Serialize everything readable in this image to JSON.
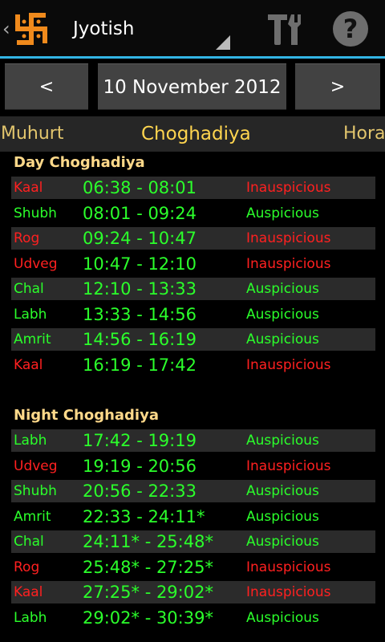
{
  "app": {
    "title": "Jyotish",
    "back_icon": "chevron-left-icon",
    "logo_icon": "swastika-logo-icon",
    "settings_icon": "tools-icon",
    "help_icon": "help-icon",
    "help_glyph": "?",
    "accent_color": "#33b5e5"
  },
  "date_nav": {
    "prev_label": "<",
    "date": "10 November 2012",
    "next_label": ">"
  },
  "tabs": {
    "left": "Muhurt",
    "active": "Choghadiya",
    "right": "Hora"
  },
  "day": {
    "title": "Day Choghadiya",
    "rows": [
      {
        "name": "Kaal",
        "time": "06:38 - 08:01",
        "status": "Inauspicious"
      },
      {
        "name": "Shubh",
        "time": "08:01 - 09:24",
        "status": "Auspicious"
      },
      {
        "name": "Rog",
        "time": "09:24 - 10:47",
        "status": "Inauspicious"
      },
      {
        "name": "Udveg",
        "time": "10:47 - 12:10",
        "status": "Inauspicious"
      },
      {
        "name": "Chal",
        "time": "12:10 - 13:33",
        "status": "Auspicious"
      },
      {
        "name": "Labh",
        "time": "13:33 - 14:56",
        "status": "Auspicious"
      },
      {
        "name": "Amrit",
        "time": "14:56 - 16:19",
        "status": "Auspicious"
      },
      {
        "name": "Kaal",
        "time": "16:19 - 17:42",
        "status": "Inauspicious"
      }
    ]
  },
  "night": {
    "title": "Night Choghadiya",
    "rows": [
      {
        "name": "Labh",
        "time": "17:42 - 19:19",
        "status": "Auspicious"
      },
      {
        "name": "Udveg",
        "time": "19:19 - 20:56",
        "status": "Inauspicious"
      },
      {
        "name": "Shubh",
        "time": "20:56 - 22:33",
        "status": "Auspicious"
      },
      {
        "name": "Amrit",
        "time": "22:33 - 24:11*",
        "status": "Auspicious"
      },
      {
        "name": "Chal",
        "time": "24:11* - 25:48*",
        "status": "Auspicious"
      },
      {
        "name": "Rog",
        "time": "25:48* - 27:25*",
        "status": "Inauspicious"
      },
      {
        "name": "Kaal",
        "time": "27:25* - 29:02*",
        "status": "Inauspicious"
      },
      {
        "name": "Labh",
        "time": "29:02* - 30:39*",
        "status": "Auspicious"
      }
    ]
  },
  "colors": {
    "auspicious": "#2bff2b",
    "inauspicious": "#ff2020",
    "section_title": "#ffd98a",
    "tab_active": "#ffd54f"
  }
}
